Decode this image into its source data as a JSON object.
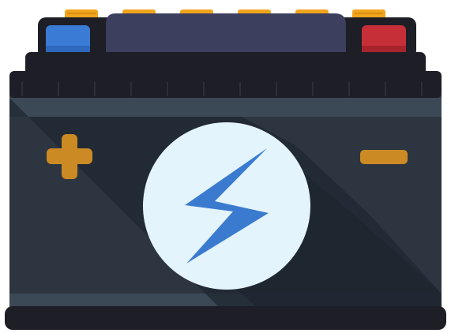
{
  "illustration": {
    "subject": "car-battery",
    "icons": [
      "lightning-bolt-icon",
      "plus-icon",
      "minus-icon"
    ],
    "colors": {
      "body_dark": "#2d3640",
      "body_band": "#3b4856",
      "top_lid": "#1d1e26",
      "label_panel": "#3c3f5e",
      "cap_yellow": "#f0a51d",
      "terminal_negative": "#3a7bd5",
      "terminal_positive": "#c62f37",
      "sign_orange": "#cc8a24",
      "emblem_circle": "#e4f4fc",
      "bolt_blue": "#3a7bd0"
    }
  }
}
